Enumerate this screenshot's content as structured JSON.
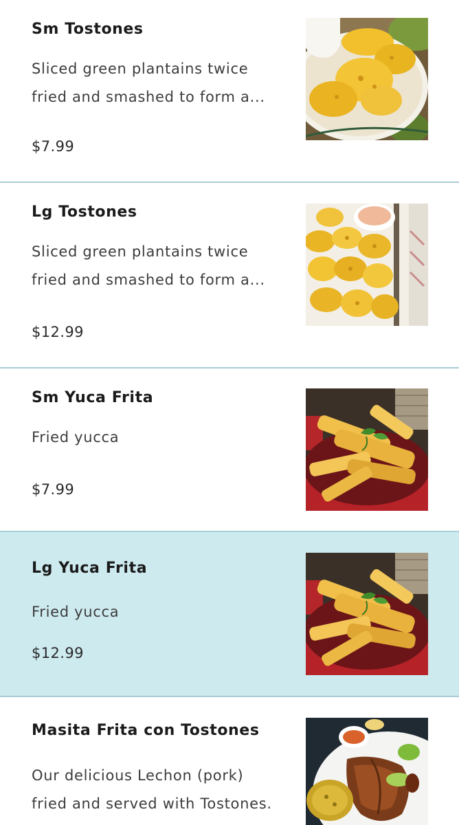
{
  "menu": {
    "items": [
      {
        "name": "Sm Tostones",
        "description": "Sliced green plantains twice\nfried and smashed to form a...",
        "price": "$7.99",
        "image_icon": "tostones-photo-icon"
      },
      {
        "name": "Lg Tostones",
        "description": "Sliced green plantains twice\nfried and smashed to form a...",
        "price": "$12.99",
        "image_icon": "tostones-photo-icon"
      },
      {
        "name": "Sm Yuca Frita",
        "description": "Fried yucca",
        "price": "$7.99",
        "image_icon": "yuca-frita-photo-icon"
      },
      {
        "name": "Lg Yuca Frita",
        "description": "Fried yucca",
        "price": "$12.99",
        "image_icon": "yuca-frita-photo-icon",
        "selected": true
      },
      {
        "name": "Masita Frita con Tostones",
        "description": "Our delicious Lechon (pork)\nfried and served with Tostones.",
        "price": "",
        "image_icon": "masita-frita-photo-icon"
      }
    ]
  },
  "colors": {
    "divider": "#a9cdd6",
    "selected_background": "#cdeaef",
    "text": "#1a1a1a"
  }
}
